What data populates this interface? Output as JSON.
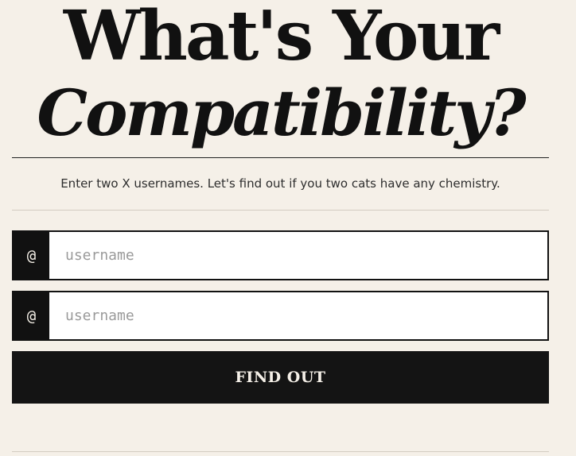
{
  "hero": {
    "title_line1": "What's Your",
    "title_line2": "Compatibility?"
  },
  "subtitle": "Enter two X usernames. Let's find out if you two cats have any chemistry.",
  "form": {
    "fields": [
      {
        "prefix": "@",
        "placeholder": "username",
        "value": ""
      },
      {
        "prefix": "@",
        "placeholder": "username",
        "value": ""
      }
    ],
    "submit_label": "FIND OUT"
  },
  "colors": {
    "background": "#f5f0e8",
    "ink": "#111111",
    "button": "#141414",
    "placeholder": "#9a9a9a"
  }
}
